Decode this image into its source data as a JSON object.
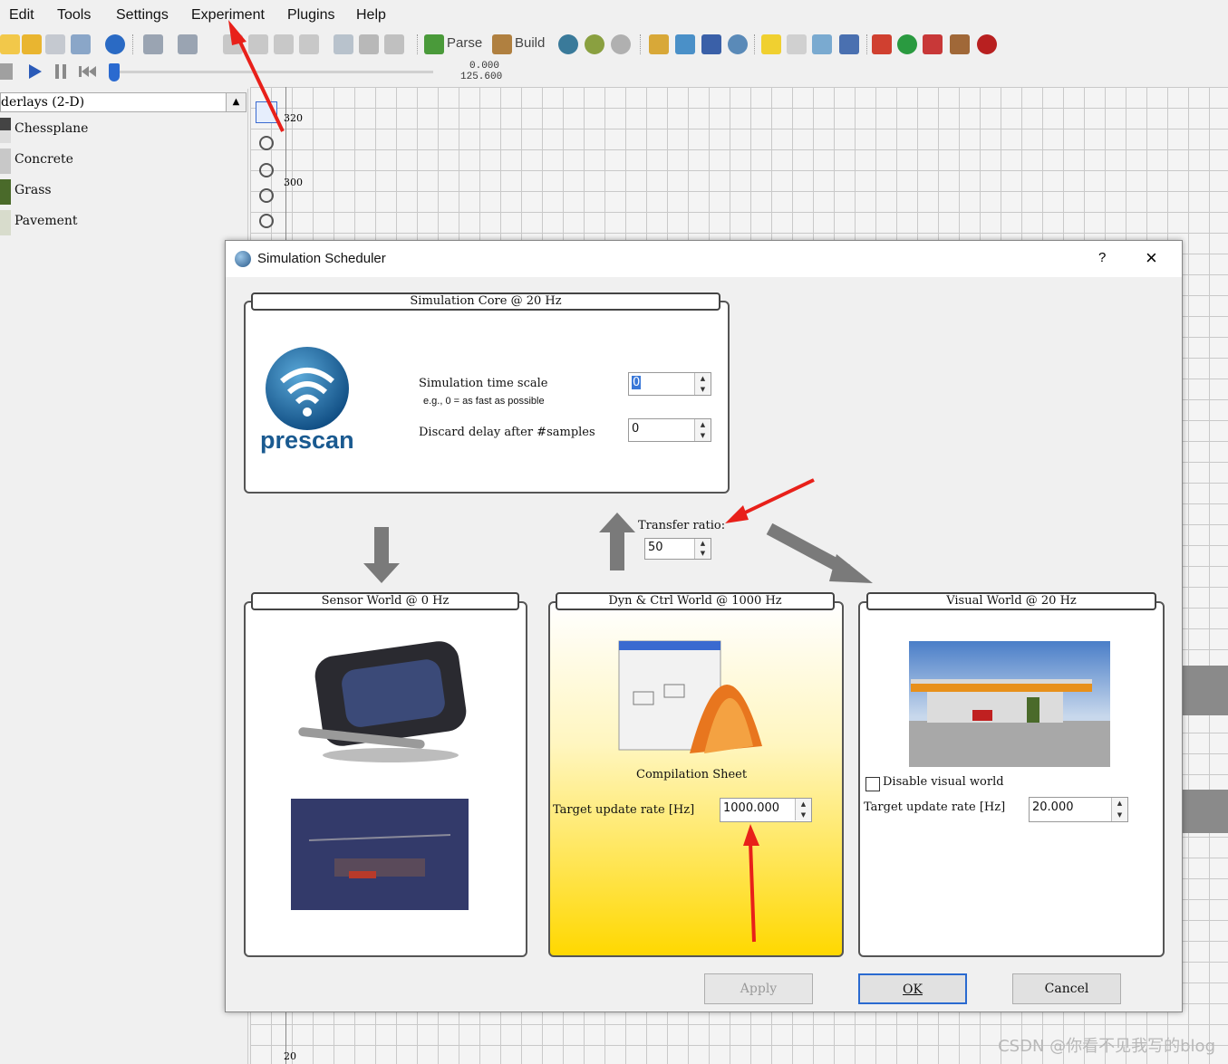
{
  "menu": {
    "items": [
      "Edit",
      "Tools",
      "Settings",
      "Experiment",
      "Plugins",
      "Help"
    ]
  },
  "toolbar": {
    "parse_label": "Parse",
    "build_label": "Build"
  },
  "playback": {
    "time_current": "0.000",
    "time_total": "125.600"
  },
  "overlays": {
    "header": "derlays (2-D)",
    "items": [
      {
        "label": "Chessplane",
        "color": "#555555"
      },
      {
        "label": "Concrete",
        "color": "#c8c8c8"
      },
      {
        "label": "Grass",
        "color": "#4a6a2a"
      },
      {
        "label": "Pavement",
        "color": "#d8dccc"
      }
    ]
  },
  "grid": {
    "y_labels": [
      "320",
      "300",
      "20"
    ]
  },
  "dialog": {
    "title": "Simulation Scheduler",
    "help_glyph": "?",
    "close_glyph": "×",
    "core": {
      "title": "Simulation Core @ 20 Hz",
      "logo_text": "prescan",
      "time_scale_label": "Simulation time scale",
      "time_scale_hint": "e.g., 0 = as fast as possible",
      "time_scale_value": "0",
      "discard_label": "Discard delay after #samples",
      "discard_value": "0"
    },
    "transfer": {
      "label": "Transfer ratio:",
      "value": "50"
    },
    "sensor": {
      "title": "Sensor World @ 0 Hz"
    },
    "dyn": {
      "title": "Dyn & Ctrl World @ 1000 Hz",
      "caption": "Compilation Sheet",
      "rate_label": "Target update rate [Hz]",
      "rate_value": "1000.000"
    },
    "visual": {
      "title": "Visual World @ 20 Hz",
      "disable_label": "Disable visual world",
      "rate_label": "Target update rate [Hz]",
      "rate_value": "20.000"
    },
    "buttons": {
      "apply": "Apply",
      "ok": "OK",
      "cancel": "Cancel"
    }
  },
  "watermark": "CSDN @你看不见我写的blog",
  "colors": {
    "annotation_red": "#e8201a",
    "dyn_gradient_top": "#ffffff",
    "dyn_gradient_bottom": "#ffd800",
    "prescan_blue": "#1a6aa0"
  }
}
